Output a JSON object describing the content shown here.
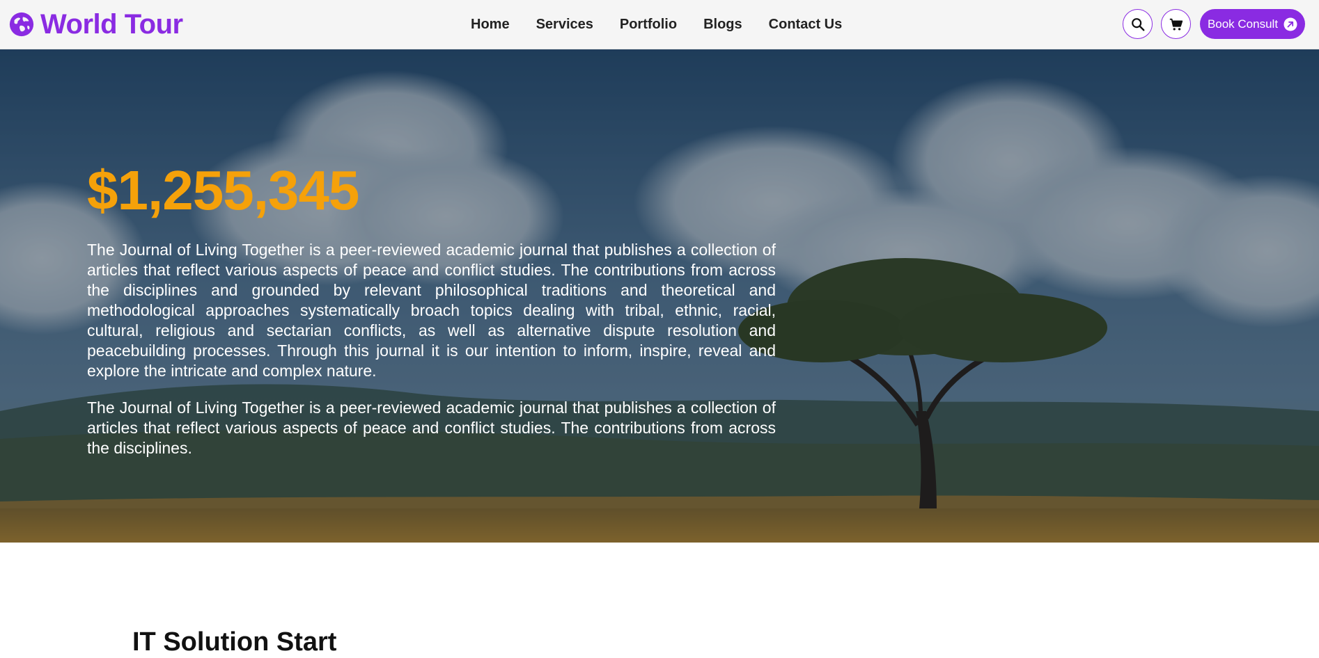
{
  "header": {
    "logo_text": "World Tour",
    "logo_icon": "globe-icon",
    "nav": [
      {
        "label": "Home"
      },
      {
        "label": "Services"
      },
      {
        "label": "Portfolio"
      },
      {
        "label": "Blogs"
      },
      {
        "label": "Contact Us"
      }
    ],
    "search_icon": "search-icon",
    "cart_icon": "cart-icon",
    "cta_label": "Book Consult",
    "cta_icon": "arrow-up-right-icon"
  },
  "hero": {
    "amount": "$1,255,345",
    "paragraphs": [
      "The Journal of Living Together is a peer-reviewed academic journal that publishes a collection of articles that reflect various aspects of peace and conflict studies. The contributions from across the disciplines and grounded by relevant philosophical traditions and theoretical and methodological approaches systematically broach topics dealing with tribal, ethnic, racial, cultural, religious and sectarian conflicts, as well as alternative dispute resolution and peacebuilding processes. Through this journal it is our intention to inform, inspire, reveal and explore the intricate and complex nature.",
      "The Journal of Living Together is a peer-reviewed academic journal that publishes a collection of articles that reflect various aspects of peace and conflict studies. The contributions from across the disciplines."
    ]
  },
  "section": {
    "heading": "IT Solution Start"
  },
  "colors": {
    "brand": "#8a2be2",
    "amount": "#f5a10a",
    "header_bg": "#f5f5f5"
  }
}
